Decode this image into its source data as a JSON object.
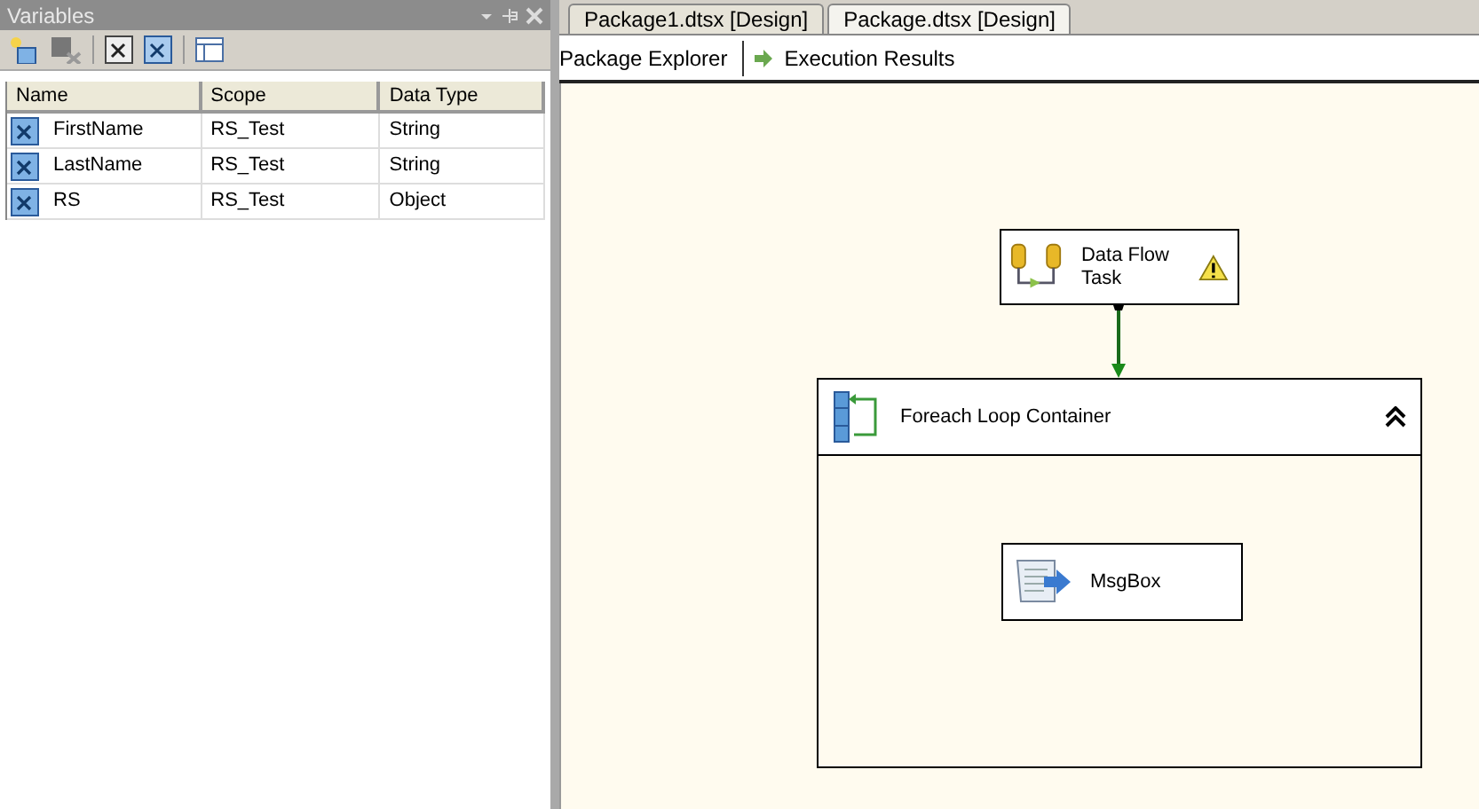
{
  "variables_panel": {
    "title": "Variables",
    "columns": [
      "Name",
      "Scope",
      "Data Type"
    ],
    "rows": [
      {
        "name": "FirstName",
        "scope": "RS_Test",
        "data_type": "String"
      },
      {
        "name": "LastName",
        "scope": "RS_Test",
        "data_type": "String"
      },
      {
        "name": "RS",
        "scope": "RS_Test",
        "data_type": "Object"
      }
    ]
  },
  "document_tabs": [
    {
      "label": "Package1.dtsx [Design]",
      "selected": false
    },
    {
      "label": "Package.dtsx [Design]",
      "selected": true
    }
  ],
  "designer_tabs": [
    {
      "label": "Package Explorer",
      "kind": "plain"
    },
    {
      "label": "Execution Results",
      "kind": "arrow"
    }
  ],
  "canvas": {
    "data_flow_task": {
      "label": "Data Flow Task",
      "warning": true
    },
    "foreach_container": {
      "label": "Foreach Loop Container",
      "expanded": true,
      "children": [
        {
          "label": "MsgBox"
        }
      ]
    }
  }
}
